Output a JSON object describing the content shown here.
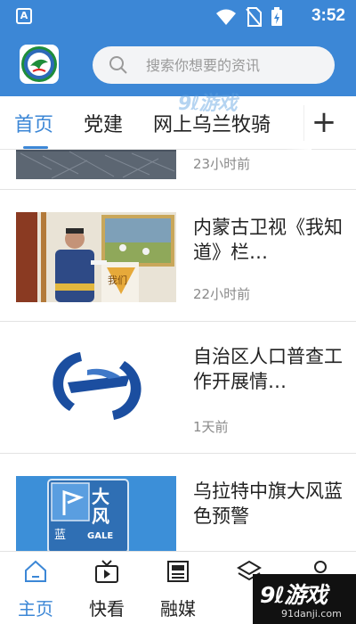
{
  "status_bar": {
    "time": "3:52",
    "app_badge": "A"
  },
  "header": {
    "search_placeholder": "搜索你想要的资讯"
  },
  "tabs": {
    "items": [
      {
        "label": "首页",
        "active": true
      },
      {
        "label": "党建",
        "active": false
      },
      {
        "label": "网上乌兰牧骑",
        "active": false
      }
    ],
    "add_label": "+"
  },
  "news": [
    {
      "title": "",
      "time": "23小时前"
    },
    {
      "title": "内蒙古卫视《我知道》栏…",
      "time": "22小时前",
      "thumb_text": "我们"
    },
    {
      "title": "自治区人口普查工作开展情…",
      "time": "1天前"
    },
    {
      "title": "乌拉特中旗大风蓝色预警",
      "time": "",
      "thumb_text": {
        "top": "大",
        "bottom": "风",
        "small": "蓝",
        "gale": "GALE"
      }
    }
  ],
  "bottom_nav": [
    {
      "label": "主页",
      "icon": "home-icon",
      "active": true
    },
    {
      "label": "快看",
      "icon": "video-icon",
      "active": false
    },
    {
      "label": "融媒",
      "icon": "newspaper-icon",
      "active": false
    },
    {
      "label": "",
      "icon": "layers-icon",
      "active": false
    },
    {
      "label": "",
      "icon": "user-icon",
      "active": false
    }
  ],
  "watermark": {
    "top": "9ℓ游戏",
    "main": "9ℓ游戏",
    "sub": "91danji.com"
  },
  "colors": {
    "accent": "#3c87d6",
    "text": "#222222",
    "muted": "#8a8a8a"
  }
}
